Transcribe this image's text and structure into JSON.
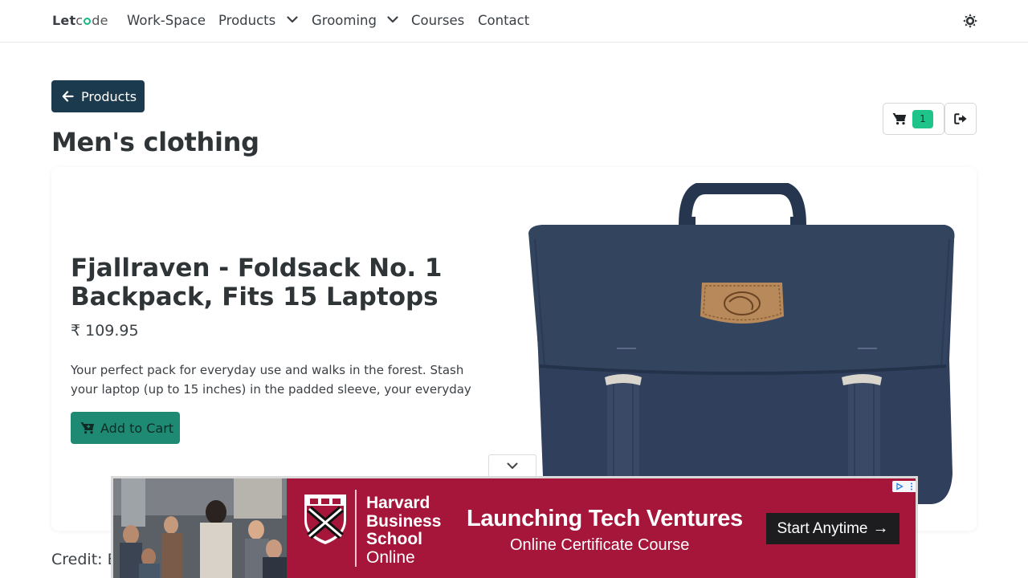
{
  "navbar": {
    "brand_left": "Let",
    "brand_right": "de",
    "items": [
      {
        "label": "Work-Space",
        "has_dropdown": false
      },
      {
        "label": "Products",
        "has_dropdown": true
      },
      {
        "label": "Grooming",
        "has_dropdown": true
      },
      {
        "label": "Courses",
        "has_dropdown": false
      },
      {
        "label": "Contact",
        "has_dropdown": false
      }
    ],
    "theme_toggle_icon": "sun-icon"
  },
  "header": {
    "back_label": "Products",
    "title": "Men's clothing",
    "cart_count": "1"
  },
  "product": {
    "title": "Fjallraven - Foldsack No. 1 Backpack, Fits 15 Laptops",
    "price": "₹ 109.95",
    "description": "Your perfect pack for everyday use and walks in the forest. Stash your laptop (up to 15 inches) in the padded sleeve, your everyday",
    "add_to_cart_label": "Add to Cart",
    "image_icon": "backpack-image"
  },
  "credit": "Credit: E",
  "ad": {
    "brand_line1": "Harvard",
    "brand_line2": "Business",
    "brand_line3": "School",
    "brand_line4": "Online",
    "headline": "Launching Tech Ventures",
    "subline": "Online Certificate Course",
    "cta_label": "Start Anytime",
    "cta_arrow": "→",
    "bg_color": "#a5163a"
  },
  "colors": {
    "accent_dark": "#1c3a4d",
    "accent_green": "#1f8a74",
    "badge_green": "#1fc48a"
  }
}
